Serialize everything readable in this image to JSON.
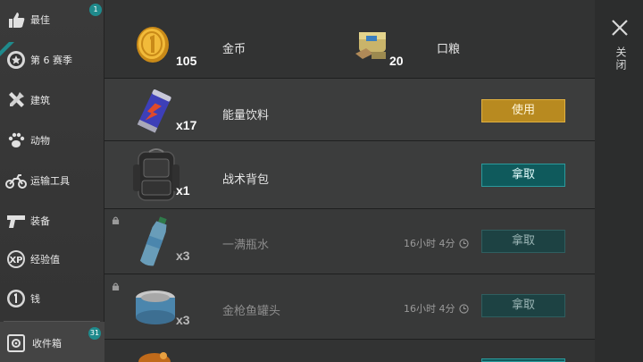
{
  "sidebar": {
    "items": [
      {
        "label": "最佳",
        "icon": "thumbs-up-icon",
        "badge": "1"
      },
      {
        "label": "第 6 赛季",
        "icon": "season-badge-icon",
        "badge": ""
      },
      {
        "label": "建筑",
        "icon": "tools-icon",
        "badge": ""
      },
      {
        "label": "动物",
        "icon": "paw-icon",
        "badge": ""
      },
      {
        "label": "运输工具",
        "icon": "motorcycle-icon",
        "badge": ""
      },
      {
        "label": "装备",
        "icon": "pistol-icon",
        "badge": ""
      },
      {
        "label": "经验值",
        "icon": "xp-icon",
        "badge": ""
      },
      {
        "label": "钱",
        "icon": "coin-icon",
        "badge": ""
      }
    ],
    "inbox": {
      "label": "收件箱",
      "icon": "inbox-icon",
      "badge": "31"
    }
  },
  "rows": [
    {
      "name": "金币",
      "qty": "105",
      "extra_name": "口粮",
      "extra_qty": "20"
    },
    {
      "name": "能量饮料",
      "qty": "x17",
      "button": "使用"
    },
    {
      "name": "战术背包",
      "qty": "x1",
      "button": "拿取"
    },
    {
      "name": "一满瓶水",
      "qty": "x3",
      "timer": "16小时 4分",
      "button": "拿取"
    },
    {
      "name": "金枪鱼罐头",
      "qty": "x3",
      "timer": "16小时 4分",
      "button": "拿取"
    }
  ],
  "close": {
    "label": "关闭"
  },
  "colors": {
    "accent_teal": "#0f5a5c",
    "accent_gold": "#b88a20"
  }
}
